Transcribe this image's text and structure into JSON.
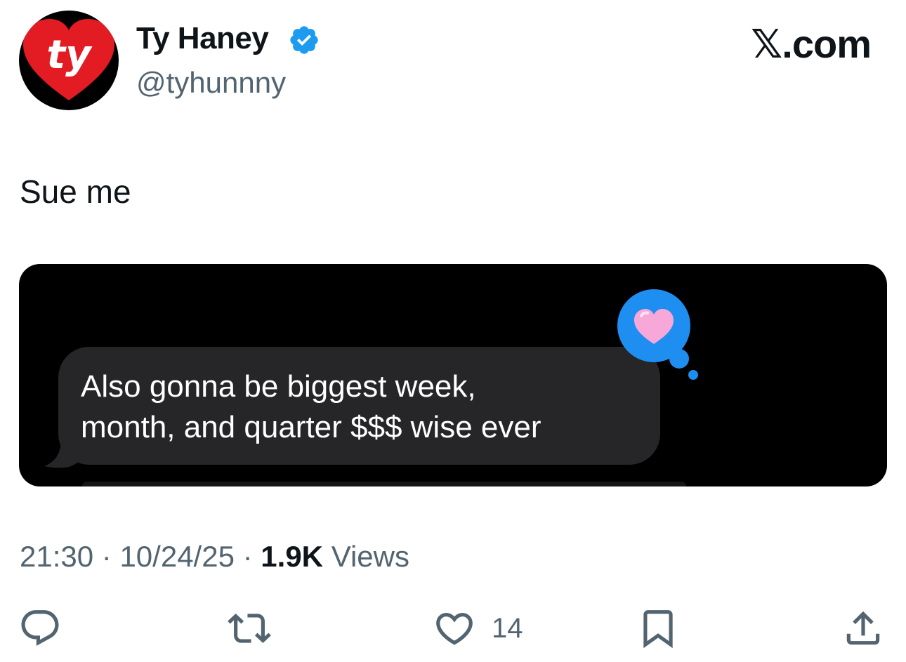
{
  "author": {
    "display_name": "Ty Haney",
    "handle": "@tyhunnny",
    "avatar_text": "ty",
    "verified": true
  },
  "branding": {
    "site": "𝕏.com"
  },
  "tweet": {
    "text": "Sue me"
  },
  "media": {
    "message_text": "Also gonna be biggest week,\nmonth, and quarter $$$ wise ever",
    "tapback_icon": "heart-reaction-icon"
  },
  "meta": {
    "time": "21:30",
    "separator": "·",
    "date": "10/24/25",
    "views_count": "1.9K",
    "views_label": "Views"
  },
  "actions": {
    "reply_icon": "reply-icon",
    "repost_icon": "repost-icon",
    "like_icon": "heart-icon",
    "like_count": "14",
    "bookmark_icon": "bookmark-icon",
    "share_icon": "share-icon"
  },
  "colors": {
    "verified_blue": "#1d9bf0",
    "text_primary": "#0f1419",
    "text_secondary": "#536471",
    "avatar_red": "#e31b23"
  }
}
